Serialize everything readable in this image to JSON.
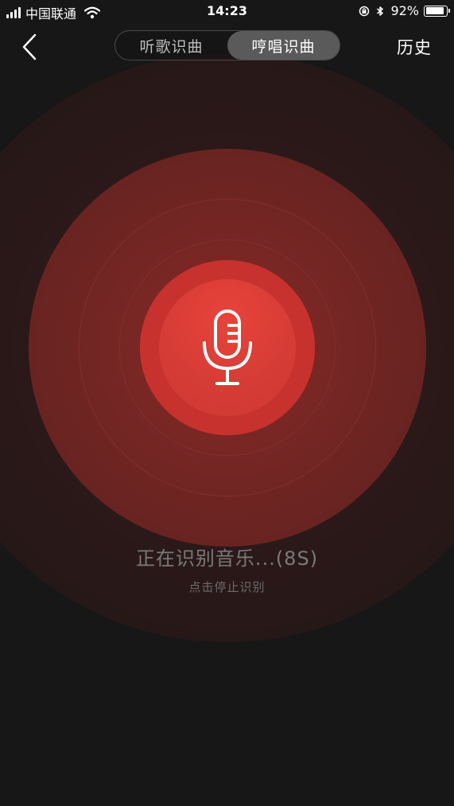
{
  "status_bar": {
    "carrier": "中国联通",
    "time": "14:23",
    "battery_percent": "92%",
    "battery_level": 0.92
  },
  "nav": {
    "tabs": [
      {
        "label": "听歌识曲",
        "active": false
      },
      {
        "label": "哼唱识曲",
        "active": true
      }
    ],
    "history_label": "历史"
  },
  "main": {
    "status": "正在识别音乐...(8S)",
    "hint": "点击停止识别"
  },
  "colors": {
    "background": "#171717",
    "accent": "#d63c36",
    "ring_mid": "#6e2522"
  },
  "icons": {
    "back": "chevron-left-icon",
    "microphone": "microphone-icon",
    "wifi": "wifi-icon",
    "bluetooth": "bluetooth-icon",
    "rotation_lock": "rotation-lock-icon"
  }
}
